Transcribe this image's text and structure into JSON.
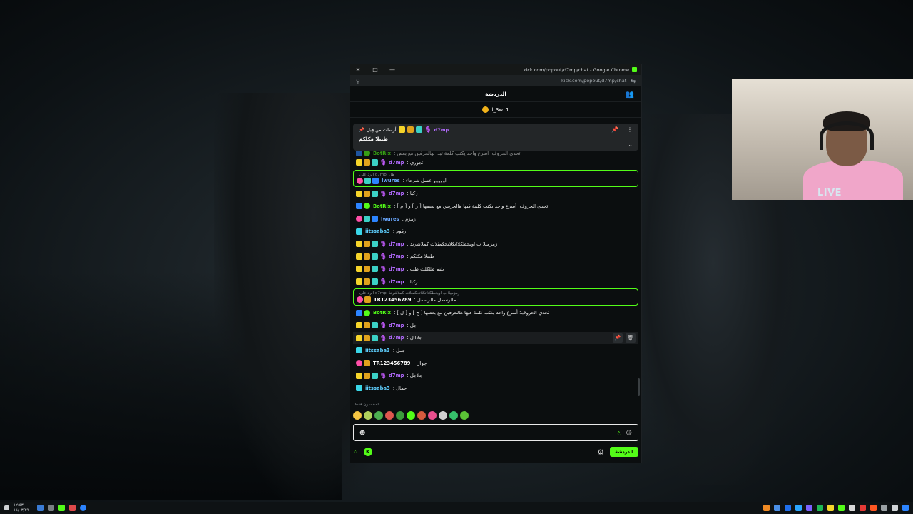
{
  "window": {
    "title": "kick.com/popout/d7mp/chat - Google Chrome",
    "url": "kick.com/popout/d7mp/chat",
    "controls": {
      "close": "✕",
      "maximize": "□",
      "minimize": "—"
    }
  },
  "chat": {
    "header_title": "الدردشة",
    "gifter": {
      "name": "l_3w",
      "count": "1"
    },
    "pinned": {
      "username": "d7mp",
      "prefix": "أرسلت من قِبل",
      "message": "طيبلا مكلكم"
    },
    "messages": [
      {
        "user": "BotRix",
        "text": "تحدي الحروف: أسرع واحد يكتب كلمة تبدأ بهالحرفين مع بعض",
        "kind": "partial"
      },
      {
        "user": "d7mp",
        "text": "تجوري",
        "kind": "normal"
      },
      {
        "user": "Iwures",
        "text": "اووووو عسل شرحاء",
        "kind": "reply",
        "reply_ctx": "الرد على d7mp: هل"
      },
      {
        "user": "d7mp",
        "text": "ركبا",
        "kind": "normal"
      },
      {
        "user": "BotRix",
        "text": "تحدي الحروف: أسرع واحد يكتب كلمة فيها هالحرفين مع بعضها [ ز ] و [ م ]",
        "kind": "bot"
      },
      {
        "user": "Iwures",
        "text": "زمزم",
        "kind": "normal"
      },
      {
        "user": "iitssaba3",
        "text": "زقوم",
        "kind": "normal"
      },
      {
        "user": "d7mp",
        "text": "زمزميلا ب اويخطكلااتكلاتحكمئلات كملاشرتذ",
        "kind": "normal"
      },
      {
        "user": "d7mp",
        "text": "طيبلا مكلكم",
        "kind": "normal"
      },
      {
        "user": "d7mp",
        "text": "يلتم طلكلت طب",
        "kind": "normal"
      },
      {
        "user": "d7mp",
        "text": "ركبا",
        "kind": "normal"
      },
      {
        "user": "TR123456789",
        "text": "مالرسمل مالرسمل",
        "kind": "reply",
        "reply_ctx": "الرد على d7mp: زمزميلا ب اويخطكلااتكلاتحكمئلات كملاشرتذ"
      },
      {
        "user": "BotRix",
        "text": "تحدي الحروف: أسرع واحد يكتب كلمة فيها هالحرفين مع بعضها [ ج ] و [ ل ]",
        "kind": "bot"
      },
      {
        "user": "d7mp",
        "text": "جل",
        "kind": "normal"
      },
      {
        "user": "d7mp",
        "text": "جلااال",
        "kind": "hover"
      },
      {
        "user": "iitssaba3",
        "text": "جمل",
        "kind": "normal"
      },
      {
        "user": "TR123456789",
        "text": "جوال",
        "kind": "normal"
      },
      {
        "user": "d7mp",
        "text": "جلاجل",
        "kind": "normal"
      },
      {
        "user": "iitssaba3",
        "text": "جمال",
        "kind": "normal"
      }
    ],
    "recent_emotes_label": "المخاسون فقط",
    "input": {
      "typed": "ع",
      "placeholder": ""
    },
    "send_label": "الدردشة",
    "colors": {
      "accent": "#53fc18",
      "background": "#0b0e0f"
    }
  },
  "webcam": {
    "live_label": "LIVE"
  },
  "taskbar": {
    "time": "١٢:٥٣",
    "date": "١٤/٠٣/٢٩"
  }
}
